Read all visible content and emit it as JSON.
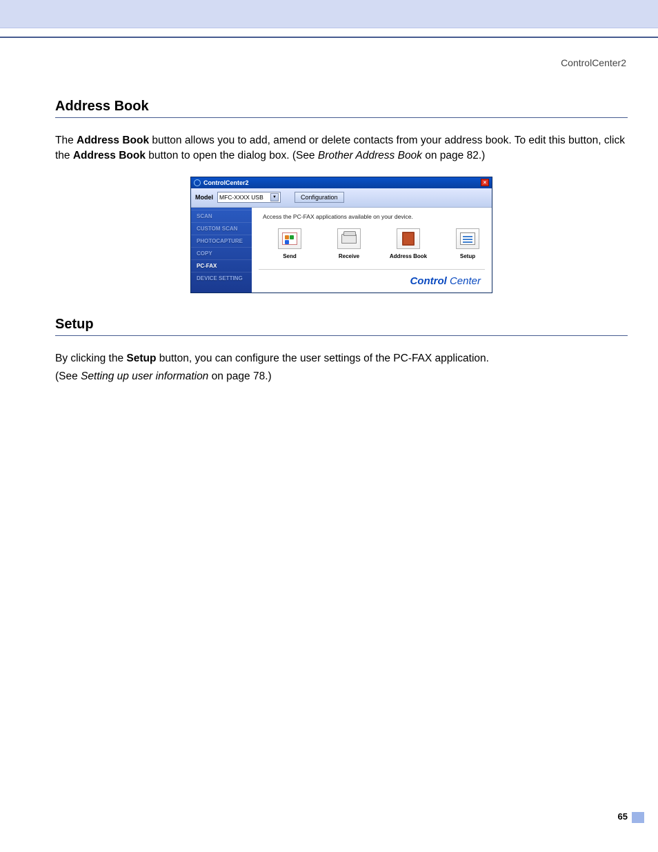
{
  "header": {
    "title": "ControlCenter2"
  },
  "section1": {
    "heading": "Address Book",
    "p1_a": "The ",
    "p1_b": "Address Book",
    "p1_c": " button allows you to add, amend or delete contacts from your address book. To edit this button, click the ",
    "p1_d": "Address Book",
    "p1_e": " button to open the dialog box. (See ",
    "p1_f": "Brother Address Book",
    "p1_g": " on page 82.)"
  },
  "screenshot": {
    "title": "ControlCenter2",
    "close": "×",
    "model_label": "Model",
    "model_value": "MFC-XXXX USB",
    "config_btn": "Configuration",
    "sidebar": [
      "SCAN",
      "CUSTOM SCAN",
      "PHOTOCAPTURE",
      "COPY",
      "PC-FAX",
      "DEVICE SETTING"
    ],
    "active_idx": 4,
    "description": "Access the   PC-FAX   applications available on  your device.",
    "icons": [
      {
        "label": "Send"
      },
      {
        "label": "Receive"
      },
      {
        "label": "Address Book"
      },
      {
        "label": "Setup"
      }
    ],
    "logo_bold": "Control",
    "logo_light": " Center"
  },
  "section2": {
    "heading": "Setup",
    "p1_a": "By clicking the ",
    "p1_b": "Setup",
    "p1_c": " button, you can configure the user settings of the PC-FAX application.",
    "p2_a": "(See ",
    "p2_b": "Setting up user information",
    "p2_c": " on page 78.)"
  },
  "page_number": "65"
}
